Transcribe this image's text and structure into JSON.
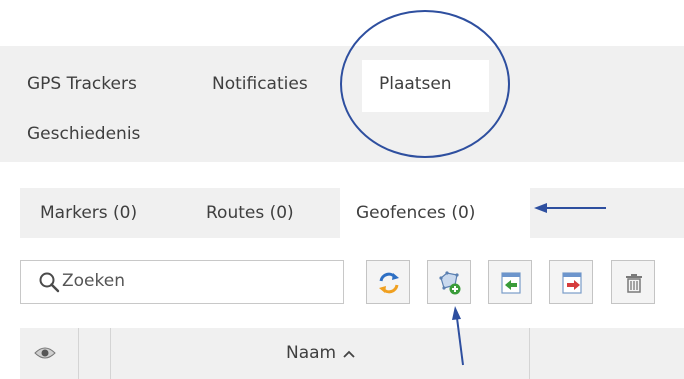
{
  "main_tabs": [
    {
      "label": "GPS Trackers",
      "active": false
    },
    {
      "label": "Notificaties",
      "active": false
    },
    {
      "label": "Plaatsen",
      "active": true
    },
    {
      "label": "Geschiedenis",
      "active": false
    }
  ],
  "sub_tabs": [
    {
      "label": "Markers (0)",
      "active": false
    },
    {
      "label": "Routes (0)",
      "active": false
    },
    {
      "label": "Geofences (0)",
      "active": true
    }
  ],
  "search": {
    "placeholder": "Zoeken"
  },
  "toolbar": {
    "buttons": [
      {
        "icon": "refresh-icon"
      },
      {
        "icon": "add-geofence-icon"
      },
      {
        "icon": "import-icon"
      },
      {
        "icon": "export-icon"
      },
      {
        "icon": "trash-icon"
      }
    ]
  },
  "grid": {
    "columns": [
      {
        "icon": "eye-icon"
      },
      {
        "label": "Naam",
        "sort": "ascending"
      }
    ]
  },
  "annotation_color": "#2e4f9f"
}
